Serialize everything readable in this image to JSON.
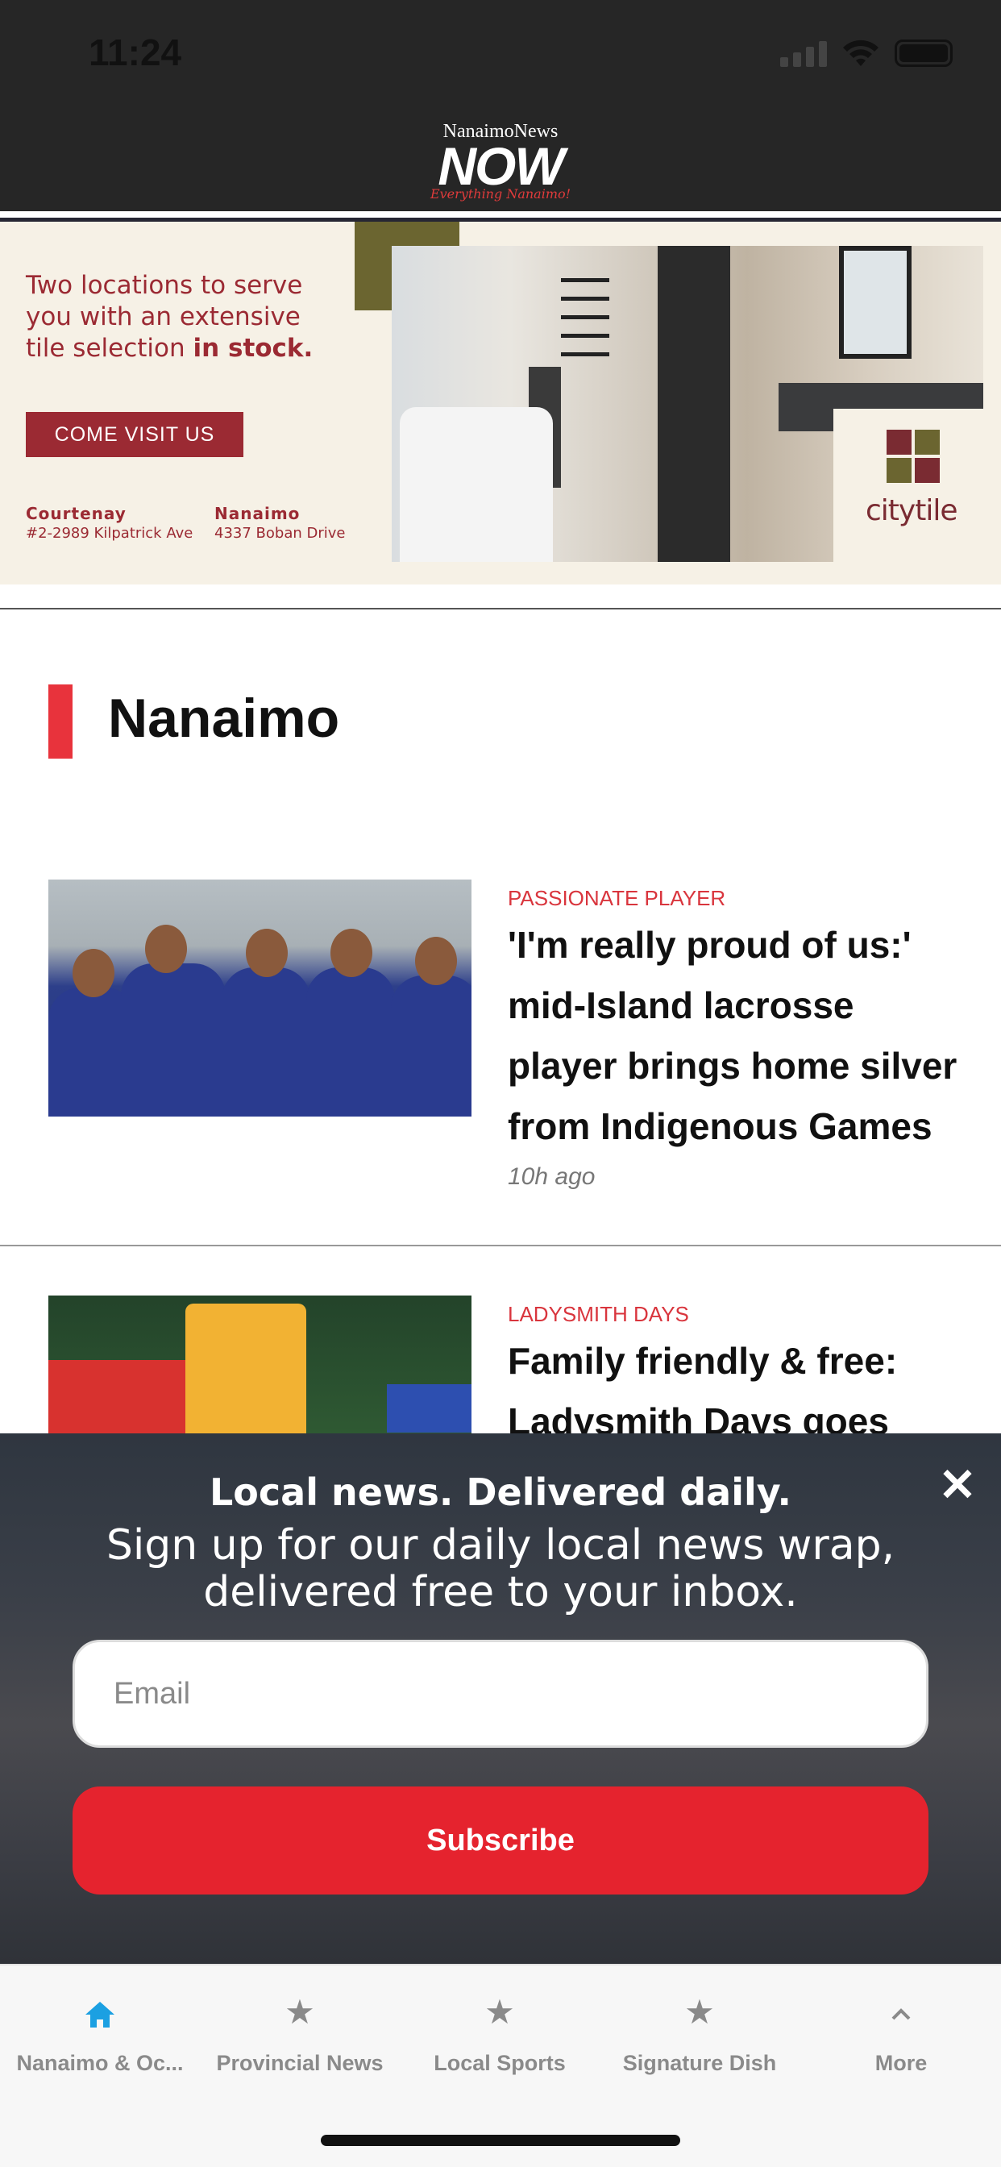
{
  "status_bar": {
    "time": "11:24"
  },
  "header": {
    "logo_top": "NanaimoNews",
    "logo_main": "NOW",
    "logo_tagline": "Everything Nanaimo!"
  },
  "ad": {
    "line1": "Two locations to serve",
    "line2": "you with an extensive",
    "line3_prefix": "tile selection ",
    "line3_bold": "in stock.",
    "button": "COME VISIT US",
    "locations": [
      {
        "city": "Courtenay",
        "address": "#2-2989 Kilpatrick Ave"
      },
      {
        "city": "Nanaimo",
        "address": "4337 Boban Drive"
      }
    ],
    "brand": "citytile",
    "colors": {
      "brand": "#9b2a33",
      "olive": "#6b6530"
    }
  },
  "section": {
    "title": "Nanaimo",
    "accent": "#e8333c"
  },
  "articles": [
    {
      "kicker": "PASSIONATE PLAYER",
      "headline": "'I'm really proud of us:' mid-Island lacrosse player brings home silver from Indigenous Games",
      "time": "10h ago"
    },
    {
      "kicker": "LADYSMITH DAYS",
      "headline": "Family friendly & free: Ladysmith Days goes",
      "time": ""
    }
  ],
  "newsletter": {
    "title": "Local news. Delivered daily.",
    "subtitle": "Sign up for our daily local news wrap, delivered free to your inbox.",
    "email_placeholder": "Email",
    "subscribe_label": "Subscribe",
    "close_icon": "close-icon",
    "accent": "#e5232e"
  },
  "tabbar": {
    "tabs": [
      {
        "label": "Nanaimo & Oc...",
        "icon": "home-icon",
        "active": true
      },
      {
        "label": "Provincial News",
        "icon": "star-icon",
        "active": false
      },
      {
        "label": "Local Sports",
        "icon": "star-icon",
        "active": false
      },
      {
        "label": "Signature Dish",
        "icon": "star-icon",
        "active": false
      },
      {
        "label": "More",
        "icon": "chevron-up-icon",
        "active": false
      }
    ],
    "active_color": "#1ba0e2"
  }
}
